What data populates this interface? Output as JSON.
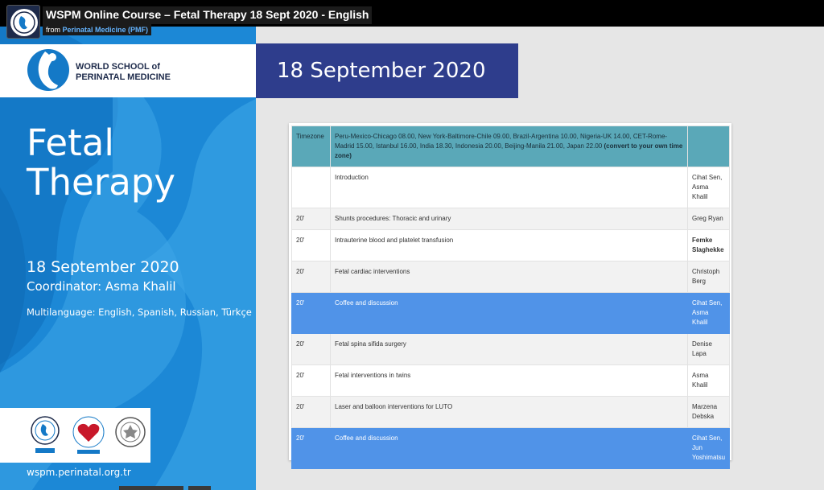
{
  "video": {
    "title": "WSPM Online Course – Fetal Therapy 18 Sept 2020 - English",
    "source_prefix": "from",
    "source_channel": "Perinatal Medicine (PMF)"
  },
  "poster": {
    "org_line1": "WORLD SCHOOL of",
    "org_line2": "PERINATAL MEDICINE",
    "title_line1": "Fetal",
    "title_line2": "Therapy",
    "date": "18 September 2020",
    "coordinator": "Coordinator: Asma Khalil",
    "languages": "Multilanguage: English, Spanish, Russian, Türkçe",
    "url": "wspm.perinatal.org.tr"
  },
  "banner": {
    "date": "18 September 2020"
  },
  "schedule": {
    "header": {
      "label": "Timezone",
      "times": "Peru-Mexico-Chicago 08.00, New York-Baltimore-Chile 09.00, Brazil-Argentina 10.00, Nigeria-UK 14.00, CET-Rome-Madrid 15.00, Istanbul 16.00, India 18.30, Indonesia 20.00, Beijing-Manila 21.00, Japan 22.00",
      "note": "(convert to your own time zone)"
    },
    "rows": [
      {
        "duration": "",
        "topic": "Introduction",
        "speaker": "Cihat Sen, Asma Khalil"
      },
      {
        "duration": "20'",
        "topic": "Shunts procedures: Thoracic and urinary",
        "speaker": "Greg Ryan"
      },
      {
        "duration": "20'",
        "topic": "Intrauterine blood and platelet transfusion",
        "speaker": "Femke Slaghekke"
      },
      {
        "duration": "20'",
        "topic": "Fetal cardiac interventions",
        "speaker": "Christoph Berg"
      },
      {
        "duration": "20'",
        "topic": "Coffee and discussion",
        "speaker": "Cihat Sen, Asma Khalil"
      },
      {
        "duration": "20'",
        "topic": "Fetal spina sifida surgery",
        "speaker": "Denise Lapa"
      },
      {
        "duration": "20'",
        "topic": "Fetal interventions in twins",
        "speaker": "Asma Khalil"
      },
      {
        "duration": "20'",
        "topic": "Laser and balloon interventions for LUTO",
        "speaker": "Marzena Debska"
      },
      {
        "duration": "20'",
        "topic": "Coffee and discussion",
        "speaker": "Cihat Sen, Jun Yoshimatsu"
      }
    ]
  },
  "colors": {
    "poster_blue": "#1479c7",
    "banner_navy": "#2e3d8c",
    "header_teal": "#5aa8b8",
    "break_blue": "#5093e8"
  }
}
